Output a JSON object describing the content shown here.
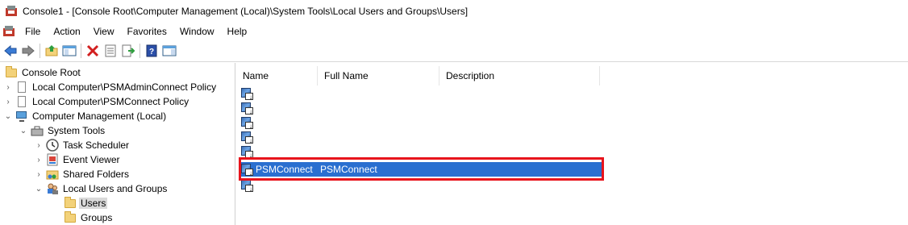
{
  "window": {
    "title": "Console1 - [Console Root\\Computer Management (Local)\\System Tools\\Local Users and Groups\\Users]"
  },
  "menu": {
    "items": [
      "File",
      "Action",
      "View",
      "Favorites",
      "Window",
      "Help"
    ]
  },
  "toolbar": {
    "buttons": [
      "back-arrow-icon",
      "forward-arrow-icon",
      "up-folder-icon",
      "show-hide-tree-icon",
      "delete-icon",
      "properties-icon",
      "export-list-icon",
      "help-icon",
      "action-pane-icon"
    ]
  },
  "tree": {
    "items": [
      {
        "label": "Console Root",
        "icon": "folder-icon",
        "level": 0,
        "expander": ""
      },
      {
        "label": "Local Computer\\PSMAdminConnect Policy",
        "icon": "policy-icon",
        "level": 0,
        "expander": ">"
      },
      {
        "label": "Local Computer\\PSMConnect Policy",
        "icon": "policy-icon",
        "level": 0,
        "expander": ">"
      },
      {
        "label": "Computer Management (Local)",
        "icon": "computer-management-icon",
        "level": 0,
        "expander": "v"
      },
      {
        "label": "System Tools",
        "icon": "system-tools-icon",
        "level": 1,
        "expander": "v"
      },
      {
        "label": "Task Scheduler",
        "icon": "clock-icon",
        "level": 2,
        "expander": ">"
      },
      {
        "label": "Event Viewer",
        "icon": "event-viewer-icon",
        "level": 2,
        "expander": ">"
      },
      {
        "label": "Shared Folders",
        "icon": "shared-folders-icon",
        "level": 2,
        "expander": ">"
      },
      {
        "label": "Local Users and Groups",
        "icon": "users-groups-icon",
        "level": 2,
        "expander": "v"
      },
      {
        "label": "Users",
        "icon": "folder-icon",
        "level": 3,
        "expander": "",
        "selected": true
      },
      {
        "label": "Groups",
        "icon": "folder-icon",
        "level": 3,
        "expander": ""
      }
    ]
  },
  "list": {
    "columns": [
      "Name",
      "Full Name",
      "Description"
    ],
    "rows": [
      {
        "name": "",
        "full_name": "",
        "description": ""
      },
      {
        "name": "",
        "full_name": "",
        "description": ""
      },
      {
        "name": "",
        "full_name": "",
        "description": ""
      },
      {
        "name": "",
        "full_name": "",
        "description": ""
      },
      {
        "name": "",
        "full_name": "",
        "description": ""
      },
      {
        "name": "PSMConnect",
        "full_name": "PSMConnect",
        "description": "",
        "selected": true
      },
      {
        "name": "",
        "full_name": "",
        "description": ""
      }
    ]
  },
  "colors": {
    "selection": "#2a6fd0",
    "highlight_box": "#e8141c",
    "tree_selection": "#d9d9d9"
  }
}
